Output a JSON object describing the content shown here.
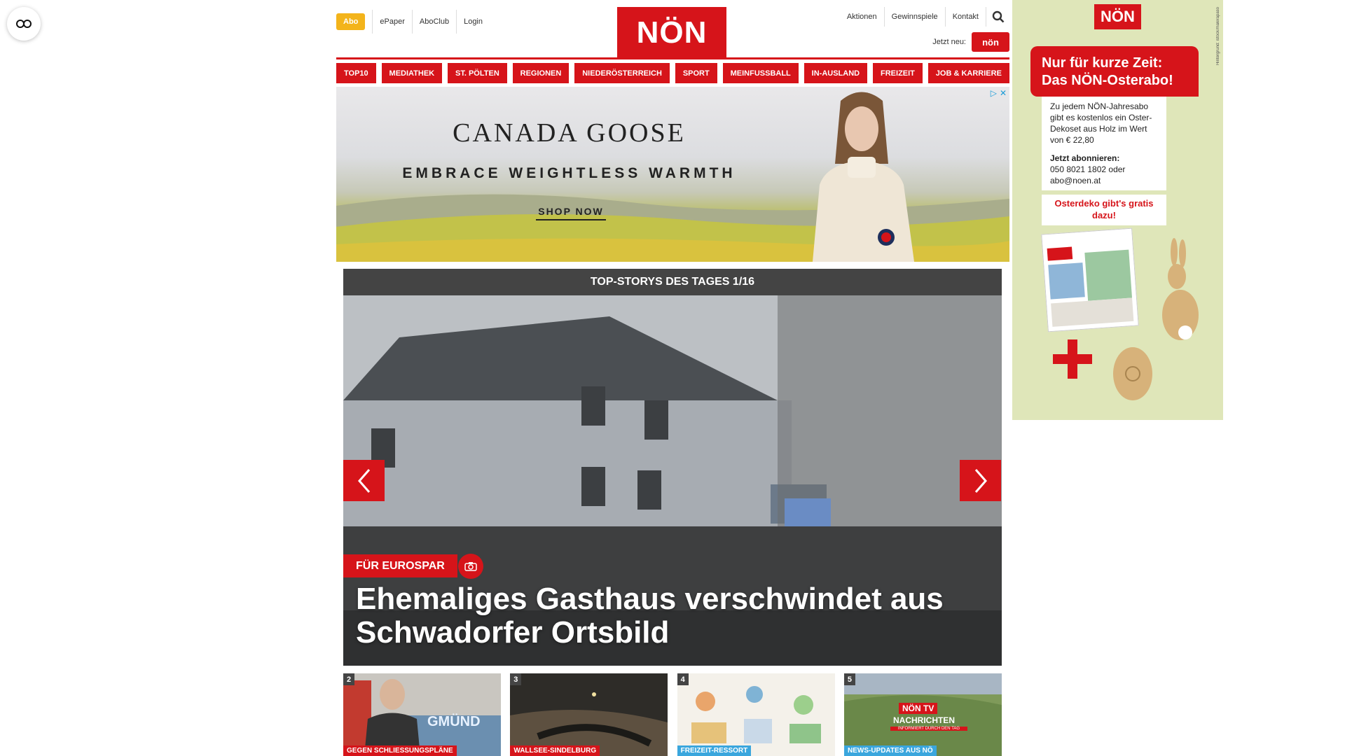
{
  "header": {
    "abo": "Abo",
    "links_left": [
      "ePaper",
      "AboClub",
      "Login"
    ],
    "logo": "NÖN",
    "links_right": [
      "Aktionen",
      "Gewinnspiele",
      "Kontakt"
    ],
    "jetzt_neu": "Jetzt neu:",
    "jetzt_badge": "nön"
  },
  "nav": [
    "TOP10",
    "MEDIATHEK",
    "ST. PÖLTEN",
    "REGIONEN",
    "NIEDERÖSTERREICH",
    "SPORT",
    "MEINFUSSBALL",
    "IN-AUSLAND",
    "FREIZEIT",
    "JOB & KARRIERE"
  ],
  "ad": {
    "brand": "CANADA GOOSE",
    "tagline": "EMBRACE WEIGHTLESS WARMTH",
    "cta": "SHOP NOW"
  },
  "carousel": {
    "heading": "TOP-STORYS DES TAGES 1/16",
    "category": "FÜR EUROSPAR",
    "title": "Ehemaliges Gasthaus verschwindet aus Schwadorfer Ortsbild"
  },
  "thumbs": [
    {
      "num": "2",
      "tag": "GEGEN SCHLIESSUNGSPLÄNE",
      "tag_color": "#d6141a"
    },
    {
      "num": "3",
      "tag": "WALLSEE-SINDELBURG",
      "tag_color": "#d6141a"
    },
    {
      "num": "4",
      "tag": "FREIZEIT-RESSORT",
      "tag_color": "#3aa6dd"
    },
    {
      "num": "5",
      "tag": "NEWS-UPDATES AUS NÖ",
      "tag_color": "#3aa6dd"
    }
  ],
  "thumb_overlay": {
    "gmund": "GMÜND",
    "tv_logo": "NÖN TV",
    "tv_title": "NACHRICHTEN",
    "tv_sub": "INFORMIERT DURCH DEN TAG"
  },
  "side_ad": {
    "logo": "NÖN",
    "headline": "Nur für kurze Zeit: Das NÖN-Osterabo!",
    "body": "Zu jedem NÖN-Jahresabo gibt es kostenlos ein Oster-Dekoset aus Holz im Wert von € 22,80",
    "subscribe_label": "Jetzt abonnieren:",
    "subscribe_contact": "050 8021 1802 oder abo@noen.at",
    "offer": "Osterdeko gibt's gratis dazu!",
    "vertical": "Hintergrund: istock/malerapaso"
  },
  "colors": {
    "brand_red": "#d6141a",
    "abo_yellow": "#f3b41b",
    "carousel_head": "#444444",
    "side_ad_bg": "#dfe6b9"
  }
}
